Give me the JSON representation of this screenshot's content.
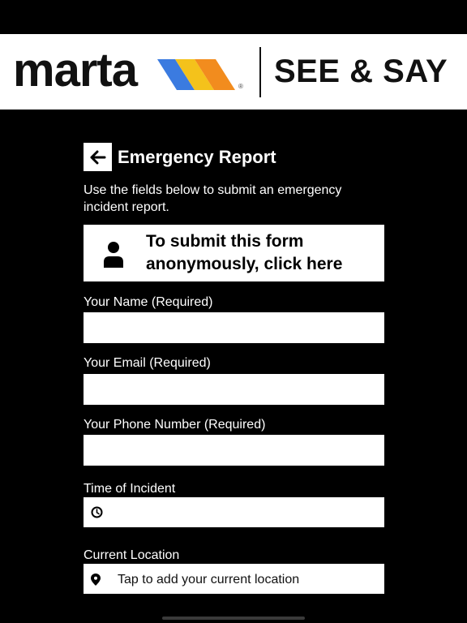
{
  "header": {
    "logo": "marta",
    "logo_mark": "®",
    "product": "SEE & SAY",
    "colors": {
      "blue": "#3B7BE0",
      "yellow": "#F4C21B",
      "orange": "#F28C1E"
    }
  },
  "page": {
    "title": "Emergency Report",
    "description": "Use the fields below to submit an emergency incident report.",
    "back_icon": "arrow-left-icon"
  },
  "anonymous": {
    "text": "To submit this form anonymously, click here",
    "icon": "person-icon"
  },
  "fields": {
    "name": {
      "label": "Your Name (Required)",
      "value": ""
    },
    "email": {
      "label": "Your Email (Required)",
      "value": ""
    },
    "phone": {
      "label": "Your Phone Number (Required)",
      "value": ""
    },
    "time": {
      "label": "Time of Incident",
      "value": "",
      "icon": "clock-icon"
    },
    "location": {
      "label": "Current Location",
      "placeholder": "Tap to add your current location",
      "icon": "location-pin-icon"
    }
  }
}
